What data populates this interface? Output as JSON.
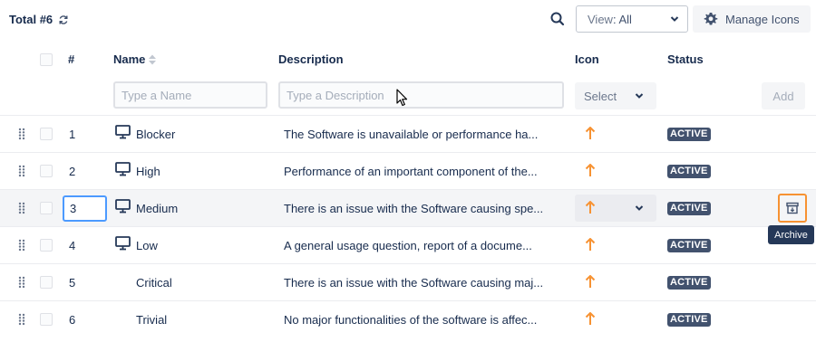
{
  "toolbar": {
    "total_label": "Total #6",
    "view_label": "View",
    "view_value": ": All",
    "manage_icons_label": "Manage Icons"
  },
  "columns": {
    "number": "#",
    "name": "Name",
    "description": "Description",
    "icon": "Icon",
    "status": "Status"
  },
  "filters": {
    "name_placeholder": "Type a Name",
    "description_placeholder": "Type a Description",
    "icon_select_label": "Select",
    "add_label": "Add"
  },
  "rows": [
    {
      "num": "1",
      "name": "Blocker",
      "description": "The Software is unavailable or performance ha...",
      "status": "ACTIVE",
      "has_icon": true
    },
    {
      "num": "2",
      "name": "High",
      "description": "Performance of an important component of the...",
      "status": "ACTIVE",
      "has_icon": true
    },
    {
      "num": "3",
      "name": "Medium",
      "description": "There is an issue with the Software causing spe...",
      "status": "ACTIVE",
      "has_icon": true
    },
    {
      "num": "4",
      "name": "Low",
      "description": "A general usage question, report of a docume...",
      "status": "ACTIVE",
      "has_icon": true
    },
    {
      "num": "5",
      "name": "Critical",
      "description": "There is an issue with the Software causing maj...",
      "status": "ACTIVE",
      "has_icon": false
    },
    {
      "num": "6",
      "name": "Trivial",
      "description": "No major functionalities of the software is affec...",
      "status": "ACTIVE",
      "has_icon": false
    }
  ],
  "tooltip": {
    "archive": "Archive"
  },
  "icons": {
    "refresh": "refresh-icon",
    "search": "search-icon",
    "gear": "gear-icon",
    "sort": "sort-icon",
    "drag": "drag-handle-icon",
    "monitor": "monitor-icon",
    "priority_arrow": "arrow-up-icon",
    "archive": "archive-icon"
  },
  "colors": {
    "accent_orange": "#f79232",
    "badge_bg": "#42526e",
    "focus_blue": "#4c9aff"
  }
}
